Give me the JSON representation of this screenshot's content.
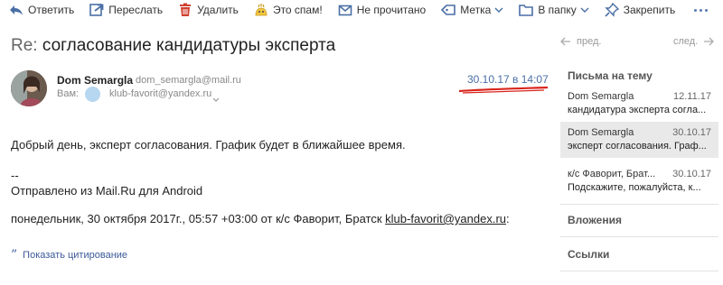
{
  "toolbar": {
    "items": [
      {
        "label": "Ответить",
        "icon": "reply-icon"
      },
      {
        "label": "Переслать",
        "icon": "forward-icon"
      },
      {
        "label": "Удалить",
        "icon": "trash-icon"
      },
      {
        "label": "Это спам!",
        "icon": "spam-icon"
      },
      {
        "label": "Не прочитано",
        "icon": "unread-icon"
      },
      {
        "label": "Метка",
        "icon": "tag-icon"
      },
      {
        "label": "В папку",
        "icon": "folder-icon"
      },
      {
        "label": "Закрепить",
        "icon": "pin-icon"
      }
    ],
    "more_icon": "more-dots-icon"
  },
  "message": {
    "subject_prefix": "Re:",
    "subject": "согласование кандидатуры эксперта",
    "sender_name": "Dom Semargla",
    "sender_email": "dom_semargla@mail.ru",
    "to_label": "Вам:",
    "to_email": "klub-favorit@yandex.ru",
    "date": "30.10.17 в 14:07",
    "body": {
      "greeting": "Добрый день,  эксперт согласования.  График будет в ближайшее  время.",
      "sig_dash": "--",
      "signature": "Отправлено из Mail.Ru для Android",
      "quote_header_prefix": "понедельник, 30 октября 2017г., 05:57 +03:00 от к/с Фаворит, Братск ",
      "quote_header_email": "klub-favorit@yandex.ru",
      "quote_header_suffix": ":"
    },
    "show_quote_label": "Показать цитирование"
  },
  "sidebar": {
    "prev_label": "пред.",
    "next_label": "след.",
    "thread_heading": "Письма на тему",
    "threads": [
      {
        "from": "Dom Semargla",
        "date": "12.11.17",
        "subject": "кандидатура эксперта согла..."
      },
      {
        "from": "Dom Semargla",
        "date": "30.10.17",
        "subject": "эксперт согласования. Граф..."
      },
      {
        "from": "к/с Фаворит, Брат...",
        "date": "30.10.17",
        "subject": "Подскажите, пожалуйста, к..."
      }
    ],
    "attachments_heading": "Вложения",
    "links_heading": "Ссылки"
  },
  "colors": {
    "accent": "#4a6fa5",
    "annotation_red": "#d9251d",
    "active_thread_bg": "#e9e9e9"
  }
}
